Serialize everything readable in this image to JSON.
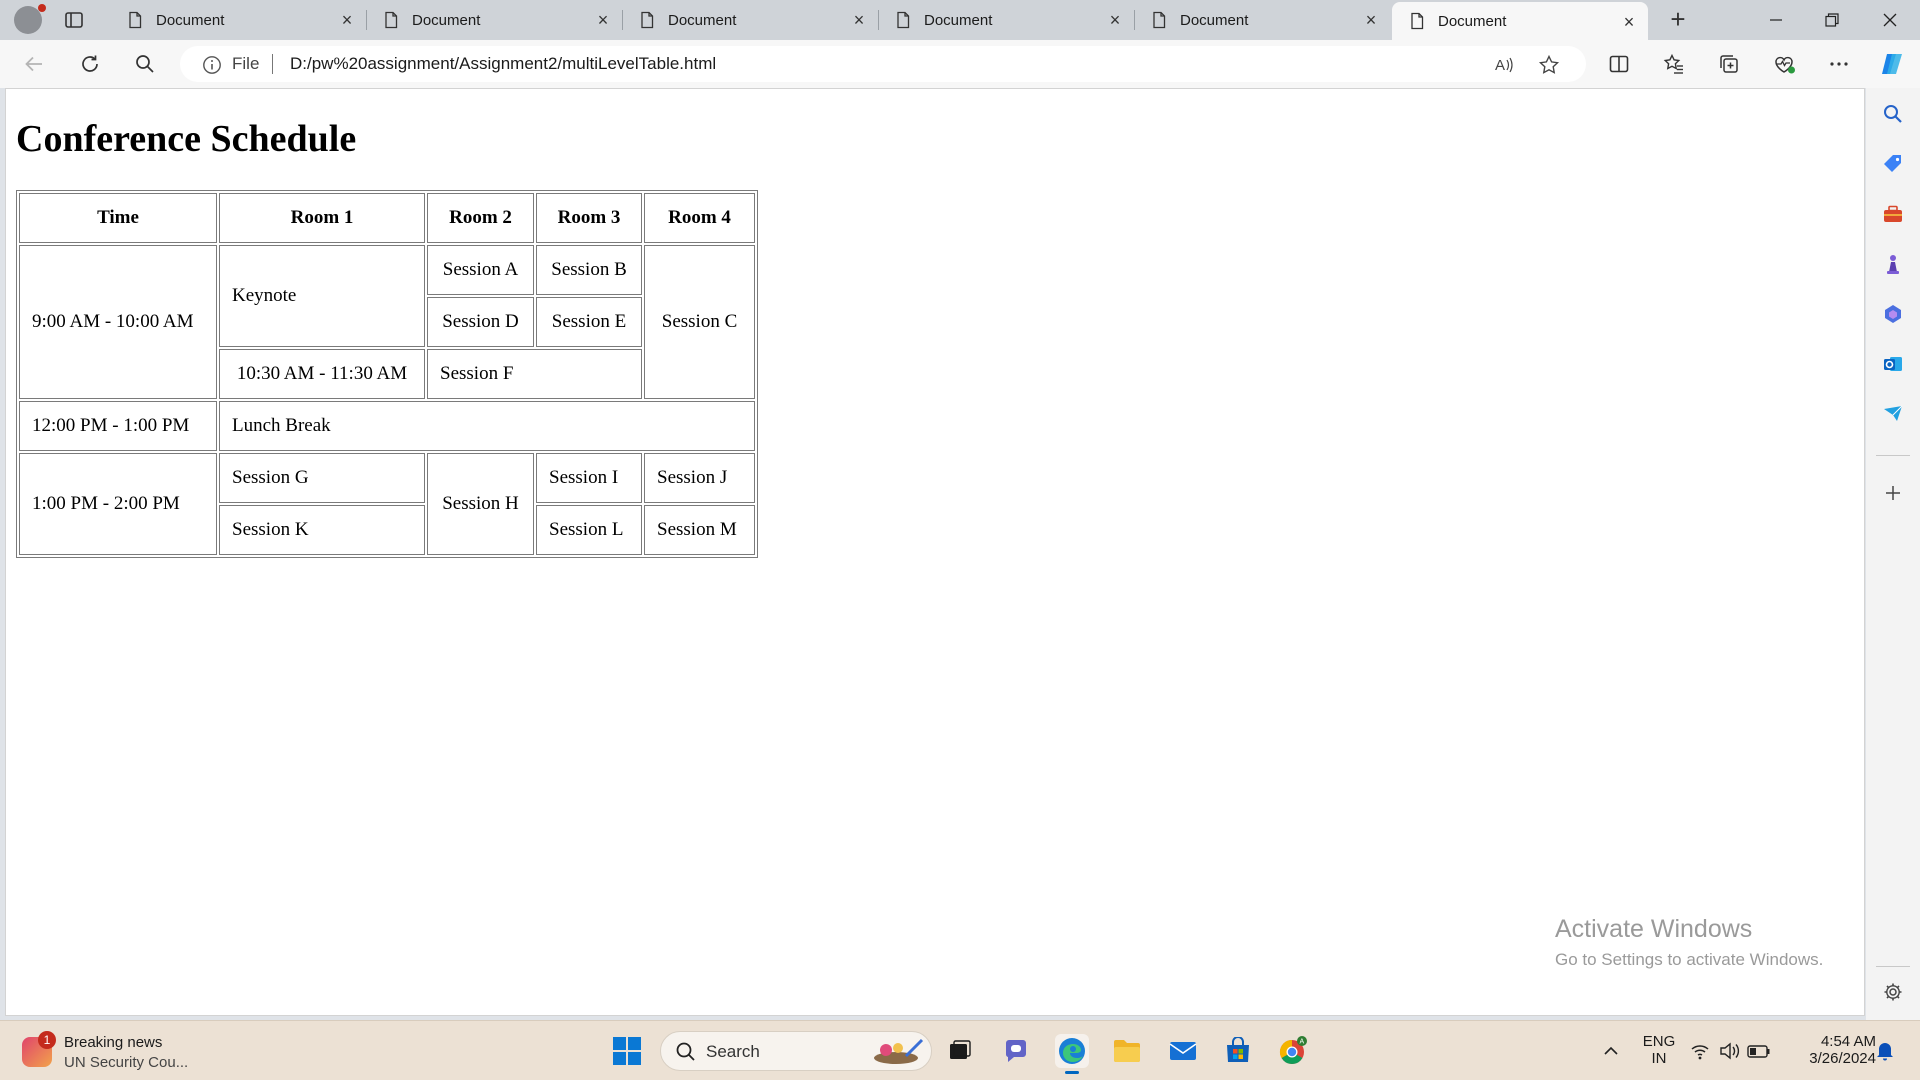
{
  "browser": {
    "tabs": [
      {
        "title": "Document",
        "active": false
      },
      {
        "title": "Document",
        "active": false
      },
      {
        "title": "Document",
        "active": false
      },
      {
        "title": "Document",
        "active": false
      },
      {
        "title": "Document",
        "active": false
      },
      {
        "title": "Document",
        "active": true
      }
    ],
    "address": {
      "scheme_label": "File",
      "url": "D:/pw%20assignment/Assignment2/multiLevelTable.html"
    }
  },
  "page": {
    "title": "Conference Schedule",
    "table": {
      "headers": [
        "Time",
        "Room 1",
        "Room 2",
        "Room 3",
        "Room 4"
      ],
      "cells": {
        "slot1_time": "9:00 AM - 10:00 AM",
        "keynote": "Keynote",
        "session_a": "Session A",
        "session_b": "Session B",
        "session_c": "Session C",
        "session_d": "Session D",
        "session_e": "Session E",
        "slot2_time": "10:30 AM - 11:30 AM",
        "session_f": "Session F",
        "slot3_time": "12:00 PM - 1:00 PM",
        "lunch": "Lunch Break",
        "slot4_time": "1:00 PM - 2:00 PM",
        "session_g": "Session G",
        "session_h": "Session H",
        "session_i": "Session I",
        "session_j": "Session J",
        "session_k": "Session K",
        "session_l": "Session L",
        "session_m": "Session M"
      }
    },
    "watermark": {
      "line1": "Activate Windows",
      "line2": "Go to Settings to activate Windows."
    }
  },
  "taskbar": {
    "news": {
      "badge": "1",
      "headline": "Breaking news",
      "subtitle": "UN Security Cou..."
    },
    "search_label": "Search",
    "language": {
      "line1": "ENG",
      "line2": "IN"
    },
    "clock": {
      "time": "4:54 AM",
      "date": "3/26/2024"
    }
  },
  "colors": {
    "tab_strip": "#cfd3d8",
    "toolbar": "#f7f7f7",
    "taskbar": "#ece1d4",
    "accent": "#0067c0"
  }
}
